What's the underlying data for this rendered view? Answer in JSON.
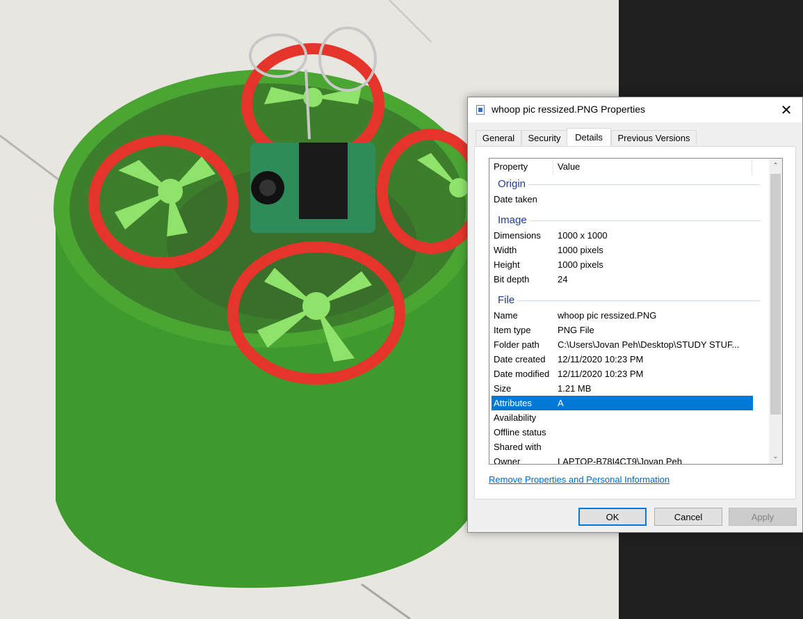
{
  "dialog": {
    "title": "whoop pic ressized.PNG Properties",
    "close_glyph": "✕",
    "tabs": [
      {
        "label": "General"
      },
      {
        "label": "Security"
      },
      {
        "label": "Details"
      },
      {
        "label": "Previous Versions"
      }
    ],
    "active_tab": "Details",
    "columns": {
      "property": "Property",
      "value": "Value"
    },
    "groups": {
      "origin": {
        "label": "Origin",
        "rows": [
          {
            "k": "Date taken",
            "v": ""
          }
        ]
      },
      "image": {
        "label": "Image",
        "rows": [
          {
            "k": "Dimensions",
            "v": "1000 x 1000"
          },
          {
            "k": "Width",
            "v": "1000 pixels"
          },
          {
            "k": "Height",
            "v": "1000 pixels"
          },
          {
            "k": "Bit depth",
            "v": "24"
          }
        ]
      },
      "file": {
        "label": "File",
        "rows": [
          {
            "k": "Name",
            "v": "whoop pic ressized.PNG"
          },
          {
            "k": "Item type",
            "v": "PNG File"
          },
          {
            "k": "Folder path",
            "v": "C:\\Users\\Jovan Peh\\Desktop\\STUDY STUF..."
          },
          {
            "k": "Date created",
            "v": "12/11/2020 10:23 PM"
          },
          {
            "k": "Date modified",
            "v": "12/11/2020 10:23 PM"
          },
          {
            "k": "Size",
            "v": "1.21 MB"
          },
          {
            "k": "Attributes",
            "v": "A"
          },
          {
            "k": "Availability",
            "v": ""
          },
          {
            "k": "Offline status",
            "v": ""
          },
          {
            "k": "Shared with",
            "v": ""
          },
          {
            "k": "Owner",
            "v": "LAPTOP-B78I4CT9\\Jovan Peh"
          }
        ]
      }
    },
    "selected_row": "Attributes",
    "remove_link": "Remove Properties and Personal Information",
    "buttons": {
      "ok": "OK",
      "cancel": "Cancel",
      "apply": "Apply"
    },
    "scroll_up_glyph": "⌃",
    "scroll_down_glyph": "⌄"
  },
  "colors": {
    "selection": "#0078d7",
    "group_header": "#1e3d90",
    "link": "#0066cc"
  }
}
